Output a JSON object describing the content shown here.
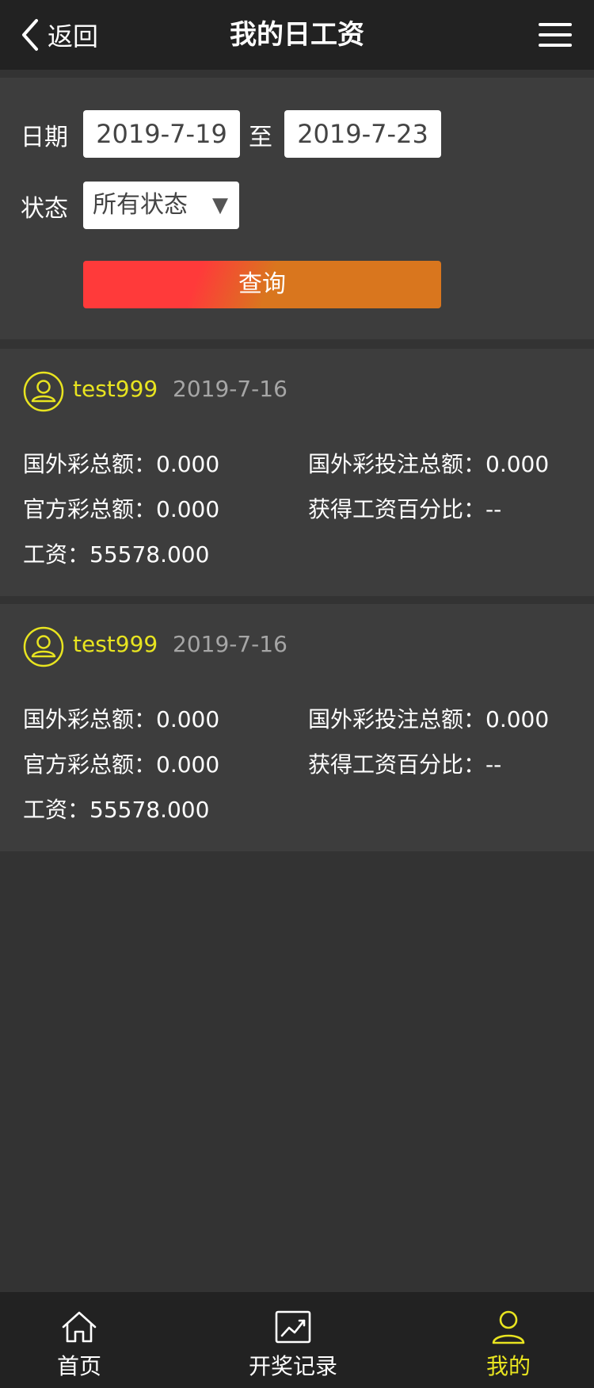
{
  "header": {
    "back_label": "返回",
    "title": "我的日工资"
  },
  "filter": {
    "date_label": "日期",
    "date_from": "2019-7-19",
    "to_label": "至",
    "date_to": "2019-7-23",
    "status_label": "状态",
    "status_value": "所有状态",
    "select_arrow": "▼",
    "query_label": "查询"
  },
  "cards": [
    {
      "username": "test999",
      "date": "2019-7-16",
      "foreign_total": "国外彩总额：0.000",
      "foreign_bet_total": "国外彩投注总额：0.000",
      "official_total": "官方彩总额：0.000",
      "wage_percent": "获得工资百分比：--",
      "wage": "工资：55578.000"
    },
    {
      "username": "test999",
      "date": "2019-7-16",
      "foreign_total": "国外彩总额：0.000",
      "foreign_bet_total": "国外彩投注总额：0.000",
      "official_total": "官方彩总额：0.000",
      "wage_percent": "获得工资百分比：--",
      "wage": "工资：55578.000"
    }
  ],
  "tabbar": {
    "items": [
      {
        "label": "首页",
        "icon": "home-icon"
      },
      {
        "label": "开奖记录",
        "icon": "trend-chart-icon"
      },
      {
        "label": "我的",
        "icon": "user-icon"
      }
    ]
  },
  "colors": {
    "accent_yellow": "#e8e420",
    "background": "#333333",
    "panel": "#3d3d3d",
    "bar": "#222222",
    "button_red": "#ff3a3a",
    "button_orange": "#d9761e"
  }
}
